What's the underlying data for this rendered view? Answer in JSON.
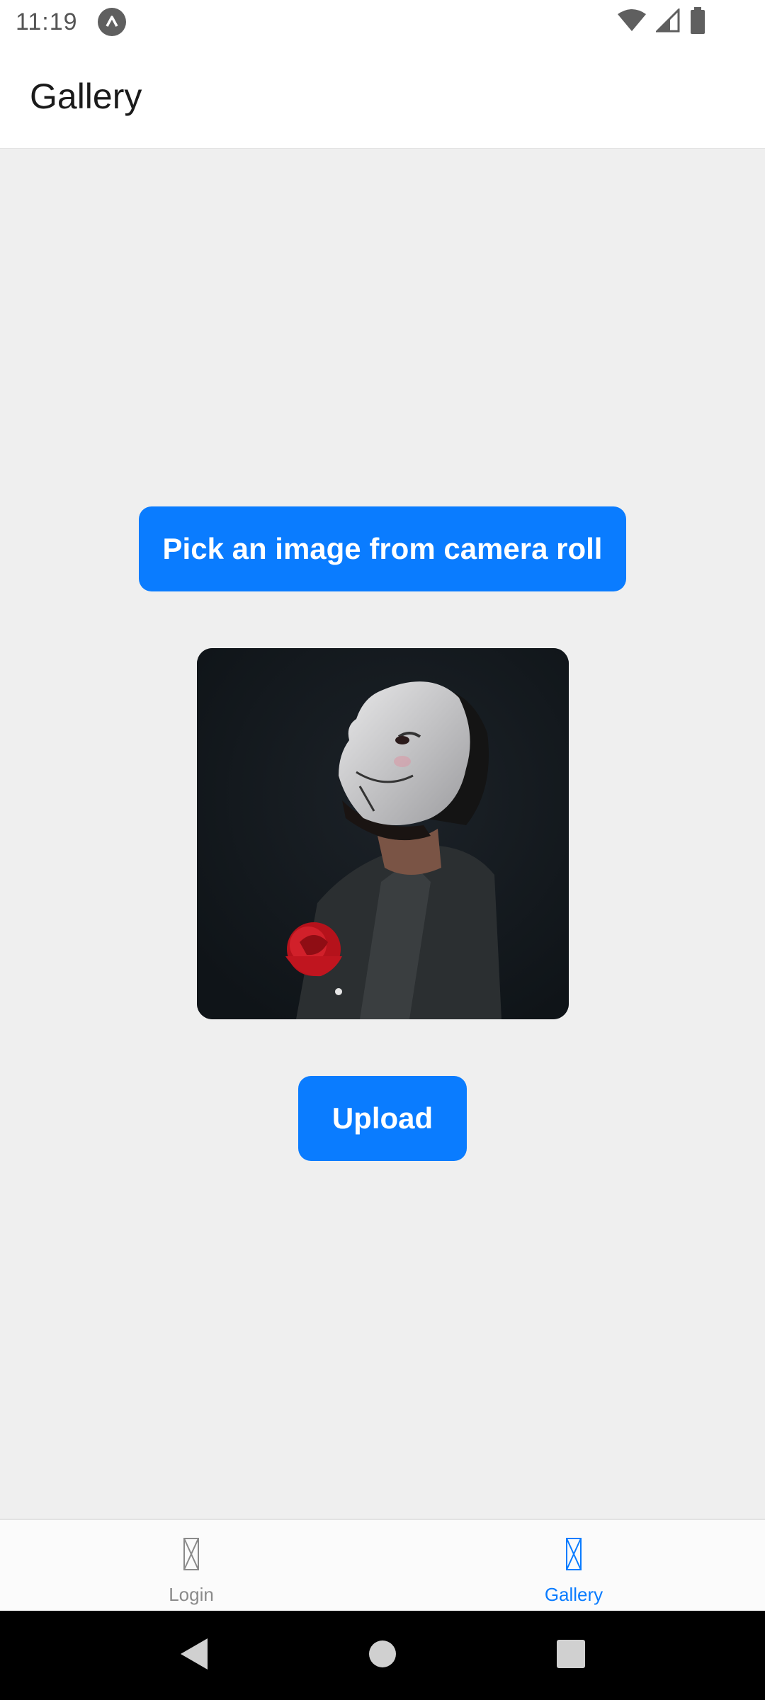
{
  "status_bar": {
    "time": "11:19",
    "icons": [
      "app-notification-icon",
      "wifi-icon",
      "cell-signal-icon",
      "battery-icon"
    ]
  },
  "header": {
    "title": "Gallery"
  },
  "main": {
    "pick_button_label": "Pick an image from camera roll",
    "upload_button_label": "Upload",
    "selected_image": "masked-person-with-red-rose"
  },
  "tabs": [
    {
      "label": "Login",
      "icon": "missing-glyph-icon",
      "active": false
    },
    {
      "label": "Gallery",
      "icon": "missing-glyph-icon",
      "active": true
    }
  ],
  "nav_bar": {
    "icons": [
      "back-icon",
      "home-icon",
      "recents-icon"
    ]
  },
  "colors": {
    "accent": "#0a7cff",
    "background": "#efefef",
    "header_bg": "#ffffff",
    "inactive_tab": "#8a8a8a"
  }
}
